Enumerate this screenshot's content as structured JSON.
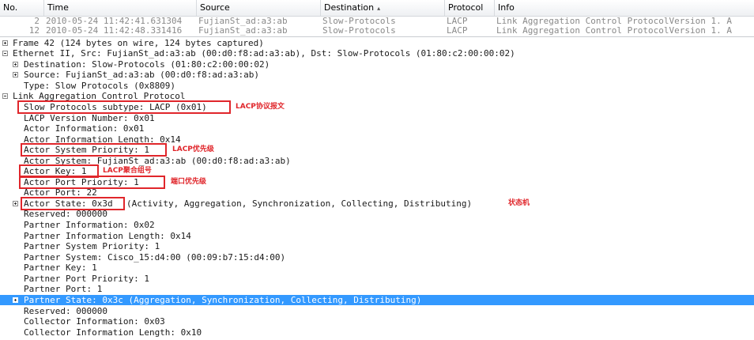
{
  "packet_list": {
    "columns": [
      {
        "key": "no",
        "label": "No."
      },
      {
        "key": "time",
        "label": "Time"
      },
      {
        "key": "source",
        "label": "Source"
      },
      {
        "key": "destination",
        "label": "Destination",
        "sorted": true
      },
      {
        "key": "protocol",
        "label": "Protocol"
      },
      {
        "key": "info",
        "label": "Info"
      }
    ],
    "rows": [
      {
        "no": "2",
        "time": "2010-05-24 11:42:41.631304",
        "source": "FujianSt_ad:a3:ab",
        "destination": "Slow-Protocols",
        "protocol": "LACP",
        "info": "Link Aggregation Control ProtocolVersion 1.  A"
      },
      {
        "no": "12",
        "time": "2010-05-24 11:42:48.331416",
        "source": "FujianSt_ad:a3:ab",
        "destination": "Slow-Protocols",
        "protocol": "LACP",
        "info": "Link Aggregation Control ProtocolVersion 1.  A"
      }
    ]
  },
  "details": {
    "frame": "Frame 42 (124 bytes on wire, 124 bytes captured)",
    "ethernet": "Ethernet II, Src: FujianSt_ad:a3:ab (00:d0:f8:ad:a3:ab), Dst: Slow-Protocols (01:80:c2:00:00:02)",
    "eth_destination": "Destination: Slow-Protocols (01:80:c2:00:00:02)",
    "eth_source": "Source: FujianSt_ad:a3:ab (00:d0:f8:ad:a3:ab)",
    "eth_type": "Type: Slow Protocols (0x8809)",
    "lacp": "Link Aggregation Control Protocol",
    "subtype": "Slow Protocols subtype: LACP (0x01)",
    "version": "LACP Version Number: 0x01",
    "actor_info": "Actor Information: 0x01",
    "actor_info_len": "Actor Information Length: 0x14",
    "actor_sys_prio": "Actor System Priority: 1",
    "actor_system": "Actor System: FujianSt_ad:a3:ab (00:d0:f8:ad:a3:ab)",
    "actor_key": "Actor Key: 1",
    "actor_port_prio": "Actor Port Priority: 1",
    "actor_port": "Actor Port: 22",
    "actor_state": "Actor State: 0x3d",
    "actor_state_flags": "(Activity, Aggregation, Synchronization, Collecting, Distributing)",
    "reserved1": "Reserved: 000000",
    "partner_info": "Partner Information: 0x02",
    "partner_info_len": "Partner Information Length: 0x14",
    "partner_sys_prio": "Partner System Priority: 1",
    "partner_system": "Partner System: Cisco_15:d4:00 (00:09:b7:15:d4:00)",
    "partner_key": "Partner Key: 1",
    "partner_port_prio": "Partner Port Priority: 1",
    "partner_port": "Partner Port: 1",
    "partner_state": "Partner State: 0x3c (Aggregation, Synchronization, Collecting, Distributing)",
    "reserved2": "Reserved: 000000",
    "collector_info": "Collector Information: 0x03",
    "collector_info_len": "Collector Information Length: 0x10"
  },
  "annotations": {
    "subtype_note": "LACP协议报文",
    "sys_prio_note": "LACP优先级",
    "key_note": "LACP聚合组号",
    "port_prio_note": "端口优先级",
    "state_note": "状态机"
  },
  "colors": {
    "selection": "#3399ff",
    "annotation_red": "#e0262b",
    "dim_text": "#8a8a8a"
  }
}
